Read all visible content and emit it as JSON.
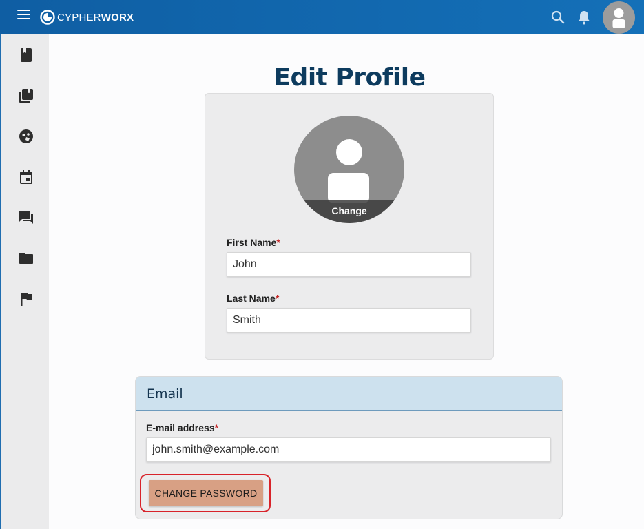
{
  "topbar": {
    "brand_light": "CYPHER",
    "brand_bold": "WORX",
    "icons": [
      "menu-icon",
      "search-icon",
      "bell-icon",
      "user-avatar-icon"
    ]
  },
  "sidebar": {
    "items": [
      {
        "icon": "book-icon"
      },
      {
        "icon": "library-books-icon"
      },
      {
        "icon": "explore-icon"
      },
      {
        "icon": "calendar-icon"
      },
      {
        "icon": "forum-icon"
      },
      {
        "icon": "folder-icon"
      },
      {
        "icon": "flag-icon"
      }
    ]
  },
  "page": {
    "title": "Edit Profile"
  },
  "profile": {
    "photo_change_label": "Change",
    "first_name_label": "First Name",
    "first_name_value": "John",
    "last_name_label": "Last Name",
    "last_name_value": "Smith",
    "required_marker": "*"
  },
  "email_section": {
    "title": "Email",
    "email_label": "E-mail address",
    "email_value": "john.smith@example.com",
    "required_marker": "*",
    "change_password_label": "CHANGE PASSWORD"
  },
  "colors": {
    "topbar": "#1470b8",
    "title": "#0d3b5e",
    "required": "#c62828",
    "email_header": "#cde1ee",
    "password_button": "#d8a084",
    "highlight_outline": "#d8232a"
  }
}
